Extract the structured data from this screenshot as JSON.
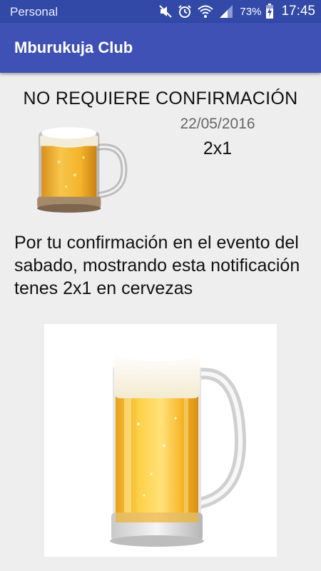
{
  "status_bar": {
    "carrier": "Personal",
    "battery": "73%",
    "time": "17:45",
    "icons": [
      "mute-icon",
      "alarm-icon",
      "wifi-icon",
      "signal-icon",
      "battery-icon"
    ]
  },
  "app_bar": {
    "title": "Mburukuja Club"
  },
  "notification": {
    "heading": "NO REQUIERE CONFIRMACIÓN",
    "date": "22/05/2016",
    "promo": "2x1",
    "message": "Por tu confirmación en el evento del sabado, mostrando esta notificación tenes 2x1 en cervezas"
  },
  "colors": {
    "status_bar": "#3249a8",
    "app_bar": "#3f51b5",
    "background": "#eeeeee",
    "beer": "#f5b82e"
  }
}
